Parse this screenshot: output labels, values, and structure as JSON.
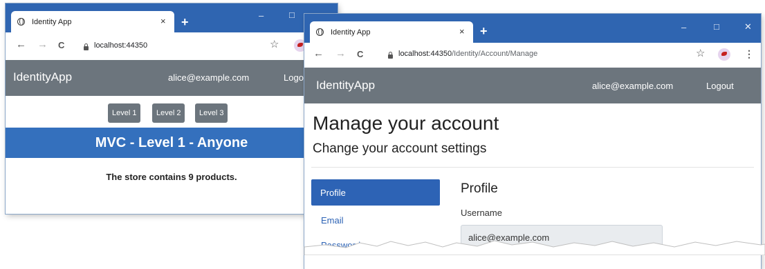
{
  "back_window": {
    "tab_title": "Identity App",
    "tab_close": "×",
    "new_tab": "+",
    "window_controls": {
      "minimize": "–",
      "maximize": "□"
    },
    "address": {
      "host": "localhost:44350",
      "path": ""
    },
    "nav": {
      "brand": "IdentityApp",
      "user": "alice@example.com",
      "logout": "Logo"
    },
    "level_buttons": [
      "Level 1",
      "Level 2",
      "Level 3"
    ],
    "banner": "MVC - Level 1 - Anyone",
    "store_text": "The store contains 9 products."
  },
  "front_window": {
    "tab_title": "Identity App",
    "tab_close": "×",
    "new_tab": "+",
    "window_controls": {
      "minimize": "–",
      "maximize": "□",
      "close": "✕"
    },
    "address": {
      "host": "localhost:44350",
      "path": "/Identity/Account/Manage"
    },
    "nav": {
      "brand": "IdentityApp",
      "user": "alice@example.com",
      "logout": "Logout"
    },
    "heading": "Manage your account",
    "subheading": "Change your account settings",
    "sidebar": [
      {
        "label": "Profile",
        "active": true
      },
      {
        "label": "Email",
        "active": false
      },
      {
        "label": "Password",
        "active": false
      }
    ],
    "section_title": "Profile",
    "username_label": "Username",
    "username_value": "alice@example.com"
  },
  "icons": {
    "back": "←",
    "forward": "→",
    "reload": "C",
    "star": "☆",
    "kebab": "⋮"
  },
  "colors": {
    "titlebar": "#2f65b1",
    "navbar": "#6c757d",
    "banner": "#3470bd",
    "active": "#2d63b5"
  }
}
